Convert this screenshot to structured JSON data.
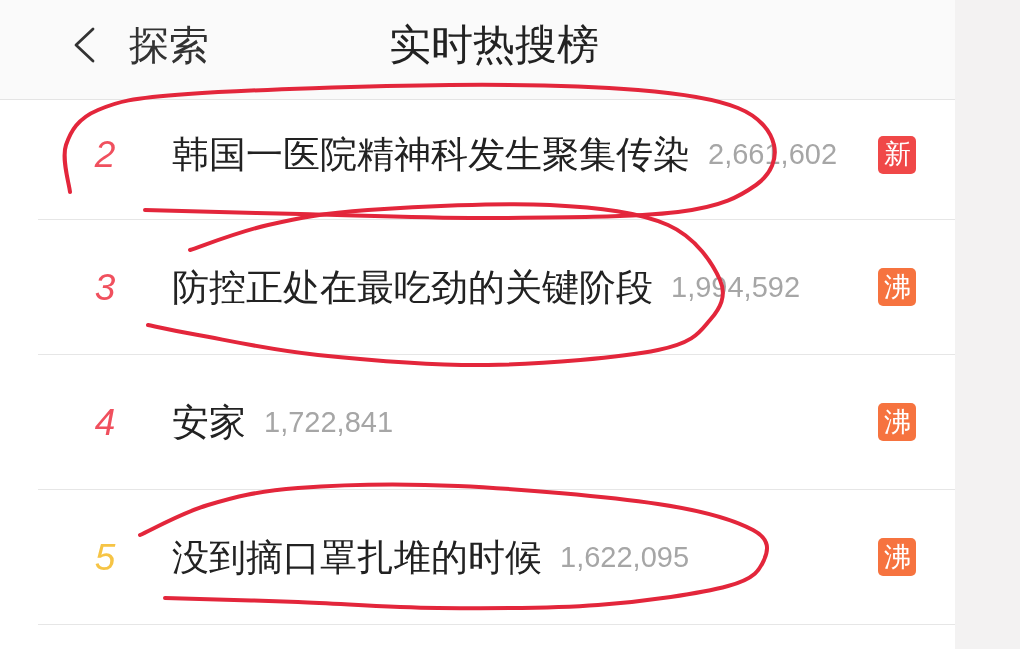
{
  "header": {
    "back_label": "探索",
    "title": "实时热搜榜"
  },
  "items": [
    {
      "rank": "2",
      "color": "#f0505e",
      "title": "韩国一医院精神科发生聚集传染",
      "count": "2,661,602",
      "badge": {
        "label": "新",
        "kind": "new"
      },
      "circled": true
    },
    {
      "rank": "3",
      "color": "#f0505e",
      "title": "防控正处在最吃劲的关键阶段",
      "count": "1,994,592",
      "badge": {
        "label": "沸",
        "kind": "hot"
      },
      "circled": true
    },
    {
      "rank": "4",
      "color": "#f0505e",
      "title": "安家",
      "count": "1,722,841",
      "badge": {
        "label": "沸",
        "kind": "hot"
      },
      "circled": false
    },
    {
      "rank": "5",
      "color": "#f6c445",
      "title": "没到摘口罩扎堆的时候",
      "count": "1,622,095",
      "badge": {
        "label": "沸",
        "kind": "hot"
      },
      "circled": true
    }
  ]
}
